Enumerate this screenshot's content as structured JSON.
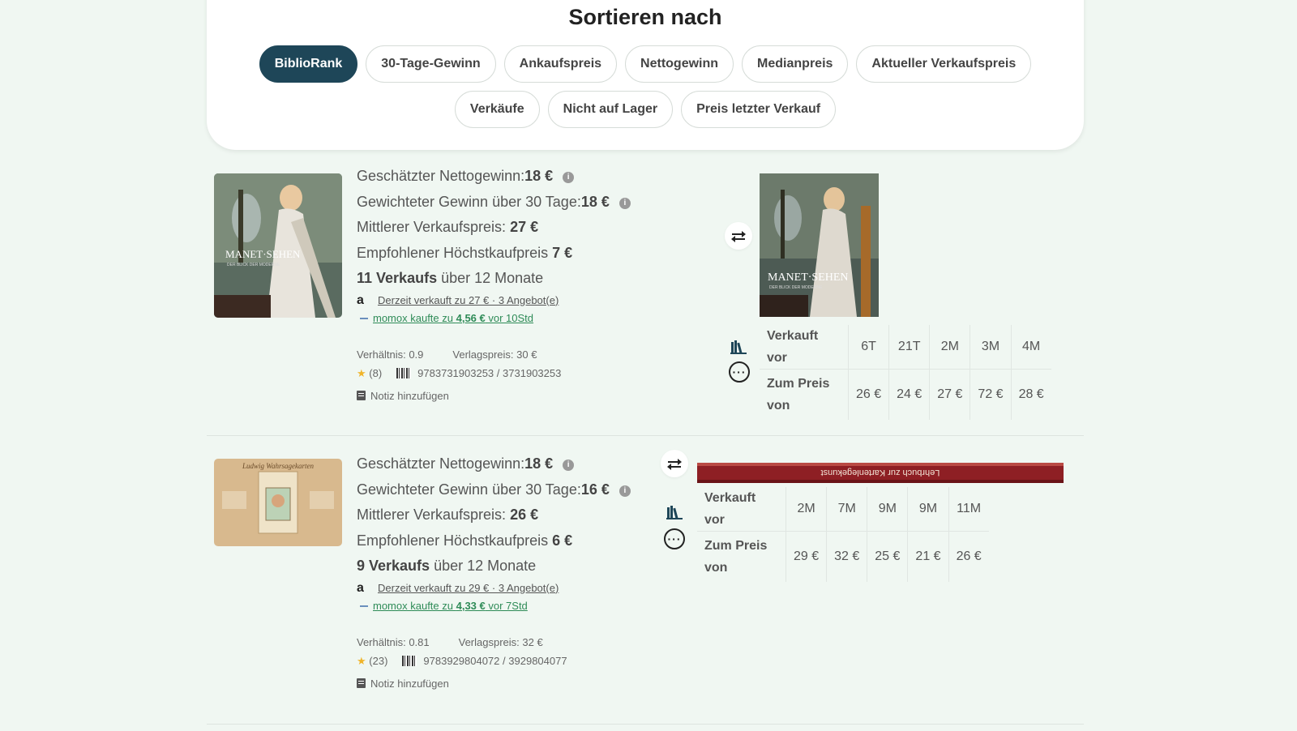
{
  "sort": {
    "title": "Sortieren nach",
    "options_row1": [
      "BiblioRank",
      "30-Tage-Gewinn",
      "Ankaufspreis",
      "Nettogewinn",
      "Medianpreis",
      "Aktueller Verkaufspreis"
    ],
    "options_row2": [
      "Verkäufe",
      "Nicht auf Lager",
      "Preis letzter Verkauf"
    ],
    "active": "BiblioRank"
  },
  "products": [
    {
      "thumb_text": "MANET·SEHEN",
      "thumb_subtext": "DER BLICK DER MODERNE",
      "net_label": "Geschätzter Nettogewinn:",
      "net_value": "18 €",
      "weighted_label": "Gewichteter Gewinn über 30 Tage:",
      "weighted_value": "18 €",
      "median_label": "Mittlerer Verkaufspreis: ",
      "median_value": "27 €",
      "max_buy_label": "Empfohlener Höchstkaufpreis ",
      "max_buy_value": "7 €",
      "sales_count": "11 Verkaufs",
      "sales_suffix": " über 12 Monate",
      "amazon_text": "Derzeit verkauft zu 27 € · 3 Angebot(e)",
      "momox_prefix": "momox kaufte zu ",
      "momox_price": "4,56 €",
      "momox_suffix": " vor 10Std",
      "ratio": "Verhältnis: 0.9",
      "publisher_price": "Verlagspreis: 30 €",
      "rating_count": "(8)",
      "isbn13": "9783731903253",
      "isbn_sep": "/",
      "isbn10": "3731903253",
      "note_label": "Notiz hinzufügen",
      "history_header": "Verkauft vor",
      "history_price_label": "Zum Preis von",
      "history_periods": [
        "6T",
        "21T",
        "2M",
        "3M",
        "4M"
      ],
      "history_prices": [
        "26 €",
        "24 €",
        "27 €",
        "72 €",
        "28 €"
      ]
    },
    {
      "thumb_text": "Ludwig Wahrsagekarten",
      "thumb_subtext": "",
      "spine_text": "Lehrbuch zur Kartenlegekunst",
      "net_label": "Geschätzter Nettogewinn:",
      "net_value": "18 €",
      "weighted_label": "Gewichteter Gewinn über 30 Tage:",
      "weighted_value": "16 €",
      "median_label": "Mittlerer Verkaufspreis: ",
      "median_value": "26 €",
      "max_buy_label": "Empfohlener Höchstkaufpreis ",
      "max_buy_value": "6 €",
      "sales_count": "9 Verkaufs",
      "sales_suffix": " über 12 Monate",
      "amazon_text": "Derzeit verkauft zu 29 € · 3 Angebot(e)",
      "momox_prefix": "momox kaufte zu ",
      "momox_price": "4,33 €",
      "momox_suffix": " vor 7Std",
      "ratio": "Verhältnis: 0.81",
      "publisher_price": "Verlagspreis: 32 €",
      "rating_count": "(23)",
      "isbn13": "9783929804072",
      "isbn_sep": "/",
      "isbn10": "3929804077",
      "note_label": "Notiz hinzufügen",
      "history_header": "Verkauft vor",
      "history_price_label": "Zum Preis von",
      "history_periods": [
        "2M",
        "7M",
        "9M",
        "9M",
        "11M"
      ],
      "history_prices": [
        "29 €",
        "32 €",
        "25 €",
        "21 €",
        "26 €"
      ]
    }
  ],
  "colors": {
    "accent": "#1e4658",
    "page_bg": "#f0f7f2",
    "momox_green": "#2e8b57",
    "star": "#f0b429"
  },
  "icons": {
    "info": "info-icon",
    "amazon": "amazon-logo-icon",
    "momox": "momox-logo-icon",
    "star": "star-icon",
    "barcode": "barcode-icon",
    "note": "note-icon",
    "swap": "swap-arrows-icon",
    "books": "books-icon",
    "more": "more-dots-icon"
  }
}
